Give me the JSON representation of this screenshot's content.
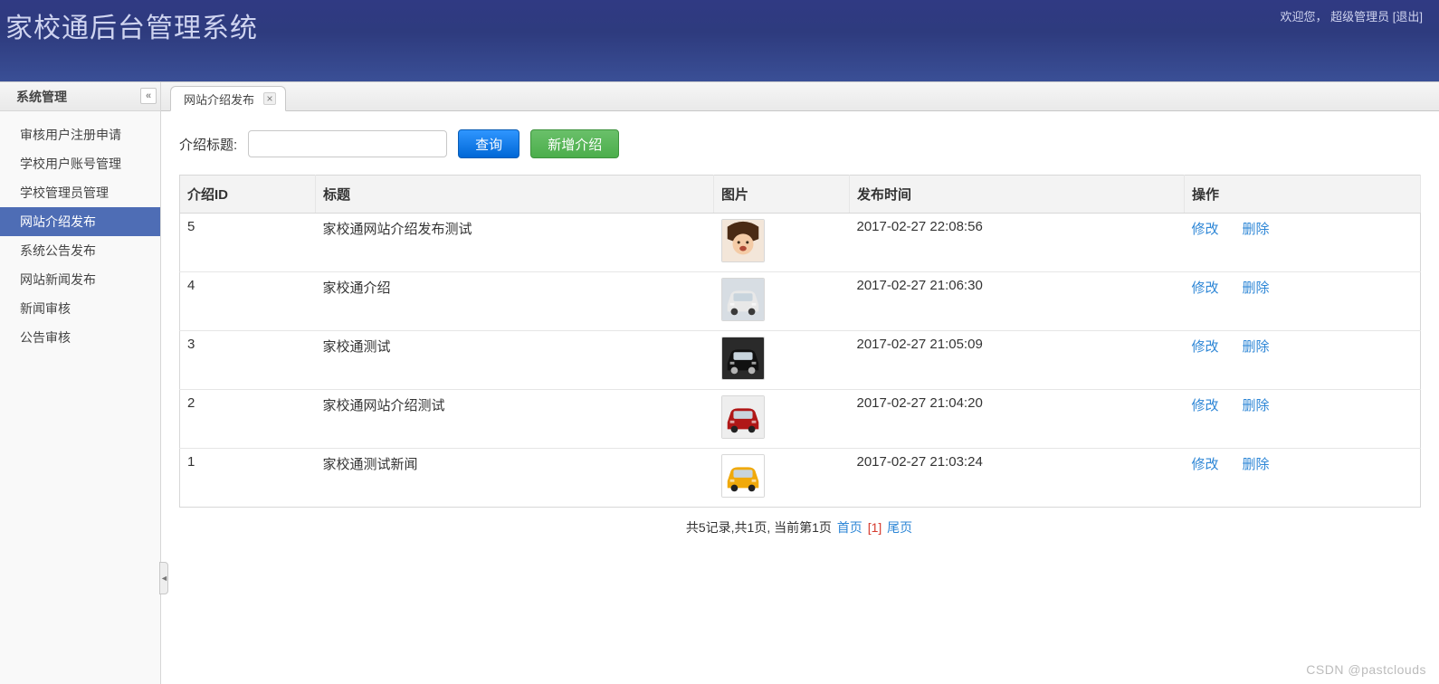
{
  "header": {
    "title": "家校通后台管理系统",
    "welcome_prefix": "欢迎您，",
    "user_name": "超级管理员",
    "logout_label": "[退出]"
  },
  "sidebar": {
    "header": "系统管理",
    "items": [
      {
        "label": "审核用户注册申请",
        "active": false
      },
      {
        "label": "学校用户账号管理",
        "active": false
      },
      {
        "label": "学校管理员管理",
        "active": false
      },
      {
        "label": "网站介绍发布",
        "active": true
      },
      {
        "label": "系统公告发布",
        "active": false
      },
      {
        "label": "网站新闻发布",
        "active": false
      },
      {
        "label": "新闻审核",
        "active": false
      },
      {
        "label": "公告审核",
        "active": false
      }
    ]
  },
  "tabs": {
    "open": [
      {
        "label": "网站介绍发布"
      }
    ]
  },
  "search": {
    "label": "介绍标题:",
    "value": "",
    "query_label": "查询",
    "add_label": "新增介绍"
  },
  "table": {
    "columns": [
      "介绍ID",
      "标题",
      "图片",
      "发布时间",
      "操作"
    ],
    "op_edit": "修改",
    "op_delete": "删除",
    "rows": [
      {
        "id": "5",
        "title": "家校通网站介绍发布测试",
        "time": "2017-02-27 22:08:56",
        "thumb": "child"
      },
      {
        "id": "4",
        "title": "家校通介绍",
        "time": "2017-02-27 21:06:30",
        "thumb": "car_white"
      },
      {
        "id": "3",
        "title": "家校通测试",
        "time": "2017-02-27 21:05:09",
        "thumb": "car_black"
      },
      {
        "id": "2",
        "title": "家校通网站介绍测试",
        "time": "2017-02-27 21:04:20",
        "thumb": "car_red"
      },
      {
        "id": "1",
        "title": "家校通测试新闻",
        "time": "2017-02-27 21:03:24",
        "thumb": "car_yellow"
      }
    ]
  },
  "pager": {
    "summary_prefix": "共",
    "total_records": "5",
    "summary_mid1": "记录,共",
    "total_pages": "1",
    "summary_mid2": "页, 当前第",
    "current_page": "1",
    "summary_suffix": "页",
    "first_label": "首页",
    "current_label": "[1]",
    "last_label": "尾页"
  },
  "watermark": "CSDN @pastclouds",
  "thumb_palette": {
    "child": {
      "bg": "#f3e6d9",
      "accent": "#4a2a14",
      "accent2": "#b04a35"
    },
    "car_white": {
      "bg": "#d7dde3",
      "accent": "#e8e8e8",
      "accent2": "#3a3a3a"
    },
    "car_black": {
      "bg": "#2a2a2a",
      "accent": "#111111",
      "accent2": "#b5b5b5"
    },
    "car_red": {
      "bg": "#eeeeee",
      "accent": "#b01717",
      "accent2": "#222222"
    },
    "car_yellow": {
      "bg": "#ffffff",
      "accent": "#f0a90a",
      "accent2": "#222222"
    }
  }
}
